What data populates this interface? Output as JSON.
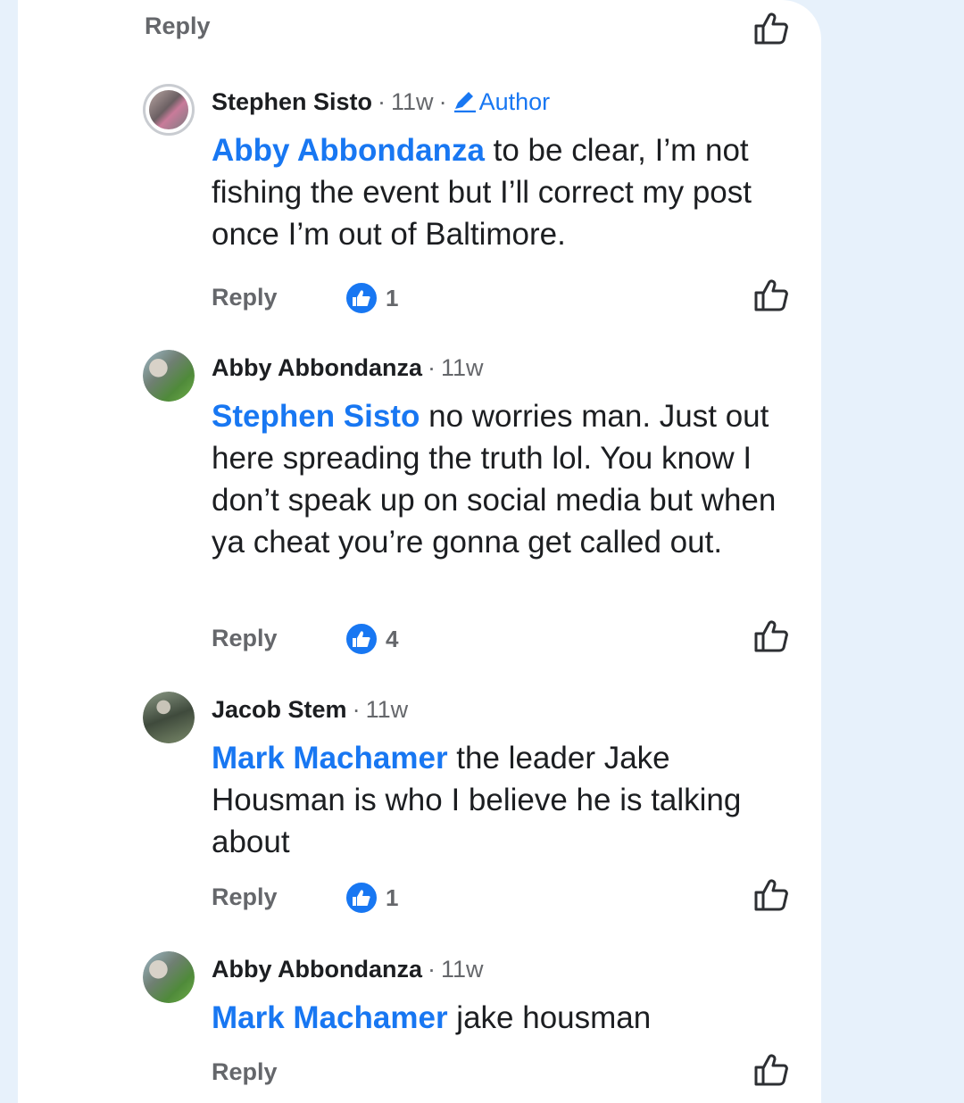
{
  "top": {
    "reply_label": "Reply"
  },
  "comments": [
    {
      "author": "Stephen Sisto",
      "time": "11w",
      "badge": "Author",
      "mention": "Abby Abbondanza",
      "text": " to be clear, I’m not fishing the event but I’ll correct my post once I’m out of Baltimore.",
      "reply_label": "Reply",
      "reaction_count": "1",
      "avatar_colors": [
        "#6b5f62",
        "#b9a7a4"
      ]
    },
    {
      "author": "Abby Abbondanza",
      "time": "11w",
      "mention": "Stephen Sisto",
      "text": " no worries man. Just out here spreading the truth lol. You know I don’t speak up on social media but when ya cheat you’re gonna get called out.",
      "reply_label": "Reply",
      "reaction_count": "4",
      "avatar_colors": [
        "#4f8a3a",
        "#9fb9c8"
      ]
    },
    {
      "author": "Jacob Stem",
      "time": "11w",
      "mention": "Mark Machamer",
      "text": " the leader Jake Housman is who I believe he is talking about",
      "reply_label": "Reply",
      "reaction_count": "1",
      "avatar_colors": [
        "#3f4a3c",
        "#8c9a86"
      ]
    },
    {
      "author": "Abby Abbondanza",
      "time": "11w",
      "mention": "Mark Machamer",
      "text": " jake housman",
      "reply_label": "Reply",
      "avatar_colors": [
        "#4f8a3a",
        "#9fb9c8"
      ]
    }
  ],
  "colors": {
    "link": "#1877f2",
    "muted": "#65676b",
    "text": "#1c1e21",
    "page_bg": "#e7f1fb"
  },
  "icons": {
    "like": "thumbs-up-outline",
    "reaction": "thumbs-up-filled-blue",
    "badge": "pencil"
  }
}
